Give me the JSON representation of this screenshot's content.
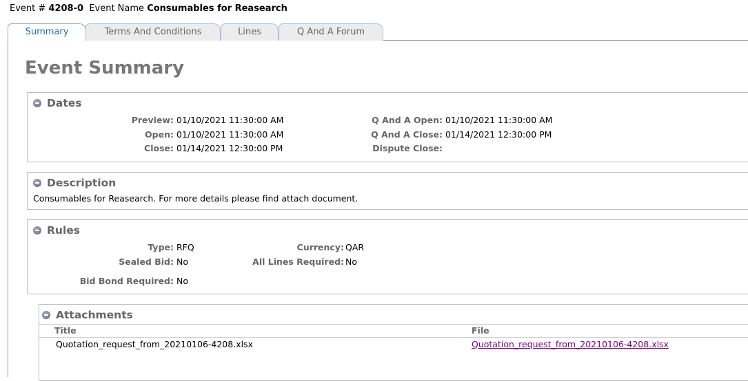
{
  "header": {
    "event_number_label": "Event #",
    "event_number": "4208-0",
    "event_name_label": "Event Name",
    "event_name": "Consumables for Reasearch"
  },
  "tabs": [
    {
      "label": "Summary",
      "active": true
    },
    {
      "label": "Terms And Conditions"
    },
    {
      "label": "Lines"
    },
    {
      "label": "Q And A Forum"
    }
  ],
  "page_title": "Event Summary",
  "dates": {
    "title": "Dates",
    "preview_label": "Preview:",
    "preview": "01/10/2021 11:30:00 AM",
    "open_label": "Open:",
    "open": "01/10/2021 11:30:00 AM",
    "close_label": "Close:",
    "close": "01/14/2021 12:30:00 PM",
    "qa_open_label": "Q And A Open:",
    "qa_open": "01/10/2021 11:30:00 AM",
    "qa_close_label": "Q And A Close:",
    "qa_close": "01/14/2021 12:30:00 PM",
    "dispute_close_label": "Dispute Close:",
    "dispute_close": ""
  },
  "description": {
    "title": "Description",
    "text": "Consumables for Reasearch. For more details please find attach document."
  },
  "rules": {
    "title": "Rules",
    "type_label": "Type:",
    "type": "RFQ",
    "currency_label": "Currency:",
    "currency": "QAR",
    "sealed_bid_label": "Sealed Bid:",
    "sealed_bid": "No",
    "all_lines_label": "All Lines Required:",
    "all_lines": "No",
    "bid_bond_label": "Bid Bond Required:",
    "bid_bond": "No"
  },
  "attachments": {
    "title": "Attachments",
    "col_title": "Title",
    "col_file": "File",
    "rows": [
      {
        "title": "Quotation_request_from_20210106-4208.xlsx",
        "file": "Quotation_request_from_20210106-4208.xlsx"
      }
    ]
  }
}
